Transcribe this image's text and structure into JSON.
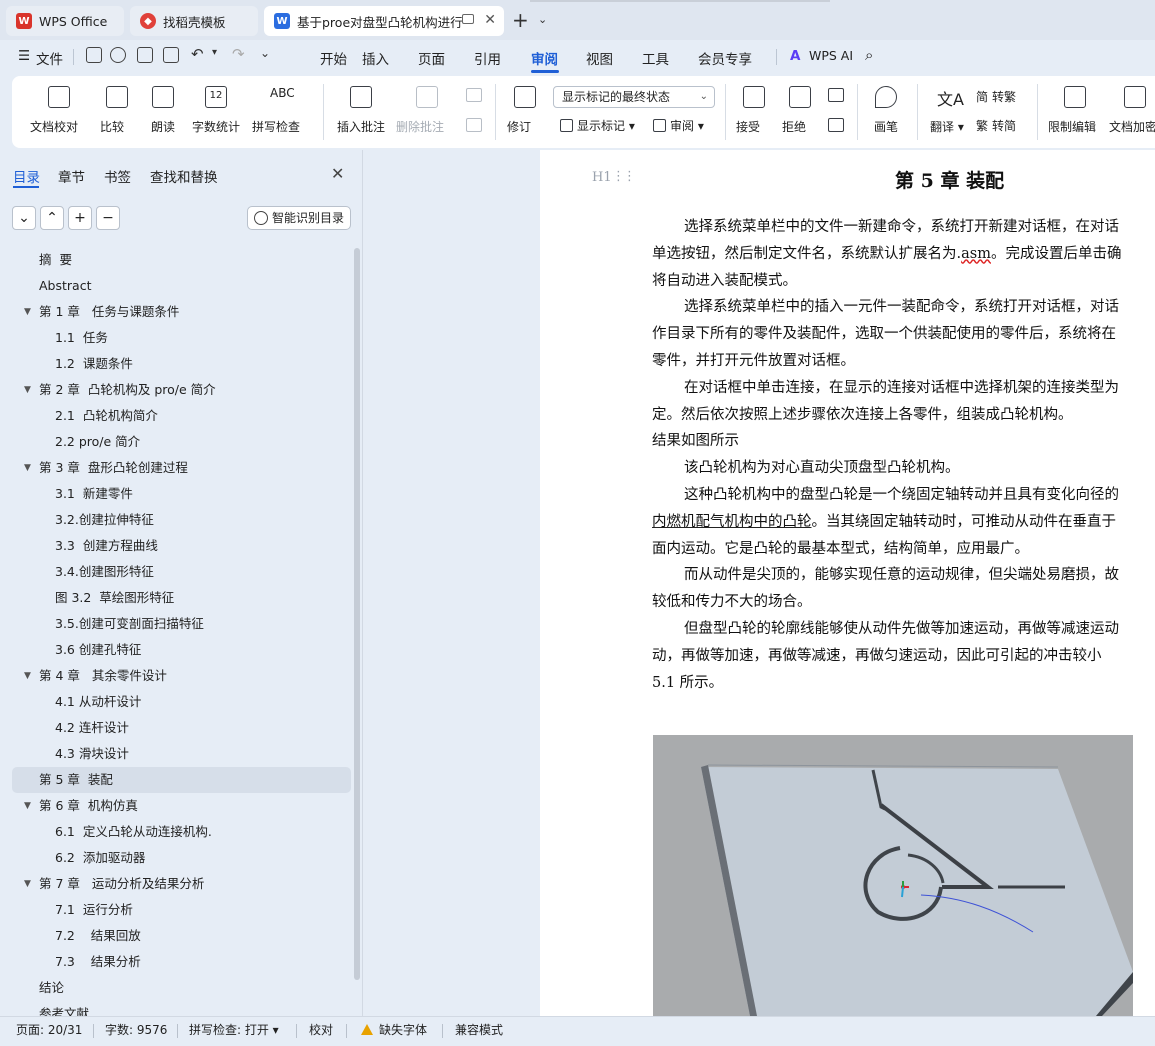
{
  "tabs": [
    {
      "label": "WPS Office",
      "icon": "wps-logo-icon"
    },
    {
      "label": "找稻壳模板",
      "icon": "docer-icon"
    },
    {
      "label": "基于proe对盘型凸轮机构进行",
      "icon": "word-doc-icon"
    }
  ],
  "menu": {
    "file": "文件",
    "items": [
      "开始",
      "插入",
      "页面",
      "引用",
      "审阅",
      "视图",
      "工具",
      "会员专享"
    ],
    "active": "审阅",
    "ai": "WPS AI"
  },
  "ribbon": {
    "proofread": "文档校对",
    "compare": "比较",
    "read_aloud": "朗读",
    "word_count": "字数统计",
    "spell_check": "拼写检查",
    "insert_comment": "插入批注",
    "delete_comment": "删除批注",
    "track_changes": "修订",
    "markup_mode": "显示标记的最终状态",
    "show_markup": "显示标记",
    "review": "审阅",
    "accept": "接受",
    "reject": "拒绝",
    "ink": "画笔",
    "translate": "翻译",
    "to_traditional": "转繁",
    "to_simplified": "转简",
    "restrict_edit": "限制编辑",
    "doc_encrypt": "文档加密"
  },
  "sidebar": {
    "tabs": [
      "目录",
      "章节",
      "书签",
      "查找和替换"
    ],
    "smart_toc": "智能识别目录",
    "toc": [
      {
        "label": "摘  要",
        "level": 1
      },
      {
        "label": "Abstract",
        "level": 1
      },
      {
        "label": "第 1 章   任务与课题条件",
        "level": 1,
        "expanded": true
      },
      {
        "label": "1.1  任务",
        "level": 2
      },
      {
        "label": "1.2  课题条件",
        "level": 2
      },
      {
        "label": "第 2 章  凸轮机构及 pro/e 简介",
        "level": 1,
        "expanded": true
      },
      {
        "label": "2.1  凸轮机构简介",
        "level": 2
      },
      {
        "label": "2.2 pro/e 简介",
        "level": 2
      },
      {
        "label": "第 3 章  盘形凸轮创建过程",
        "level": 1,
        "expanded": true
      },
      {
        "label": "3.1  新建零件",
        "level": 2
      },
      {
        "label": "3.2.创建拉伸特征",
        "level": 2
      },
      {
        "label": "3.3  创建方程曲线",
        "level": 2
      },
      {
        "label": "3.4.创建图形特征",
        "level": 2
      },
      {
        "label": "图 3.2  草绘图形特征",
        "level": 2
      },
      {
        "label": "3.5.创建可变剖面扫描特征",
        "level": 2
      },
      {
        "label": "3.6 创建孔特征",
        "level": 2
      },
      {
        "label": "第 4 章   其余零件设计",
        "level": 1,
        "expanded": true
      },
      {
        "label": "4.1 从动杆设计",
        "level": 2
      },
      {
        "label": "4.2 连杆设计",
        "level": 2
      },
      {
        "label": "4.3 滑块设计",
        "level": 2
      },
      {
        "label": "第 5 章  装配",
        "level": 1,
        "selected": true
      },
      {
        "label": "第 6 章  机构仿真",
        "level": 1,
        "expanded": true
      },
      {
        "label": "6.1  定义凸轮从动连接机构.",
        "level": 2
      },
      {
        "label": "6.2  添加驱动器",
        "level": 2
      },
      {
        "label": "第 7 章   运动分析及结果分析",
        "level": 1,
        "expanded": true
      },
      {
        "label": "7.1  运行分析",
        "level": 2
      },
      {
        "label": "7.2    结果回放",
        "level": 2
      },
      {
        "label": "7.3    结果分析",
        "level": 2
      },
      {
        "label": "结论",
        "level": 1
      },
      {
        "label": "参考文献",
        "level": 1
      }
    ]
  },
  "document": {
    "heading_marker": "H1",
    "chapter_title": "第 5 章  装配",
    "lines": [
      {
        "text": "选择系统菜单栏中的文件一新建命令，系统打开新建对话框，在对话",
        "indent": true
      },
      {
        "pre": "单选按钮，然后制定文件名，系统默认扩展名为.",
        "mark": "asm",
        "post": "。完成设置后单击确"
      },
      {
        "text": "将自动进入装配模式。"
      },
      {
        "text": "选择系统菜单栏中的插入一元件一装配命令，系统打开对话框，对话",
        "indent": true
      },
      {
        "text": "作目录下所有的零件及装配件，选取一个供装配使用的零件后，系统将在"
      },
      {
        "text": "零件，并打开元件放置对话框。"
      },
      {
        "text": "在对话框中单击连接，在显示的连接对话框中选择机架的连接类型为",
        "indent": true
      },
      {
        "text": "定。然后依次按照上述步骤依次连接上各零件，组装成凸轮机构。"
      },
      {
        "text": "结果如图所示"
      },
      {
        "text": "该凸轮机构为对心直动尖顶盘型凸轮机构。",
        "indent": true
      },
      {
        "text": "这种凸轮机构中的盘型凸轮是一个绕固定轴转动并且具有变化向径的",
        "indent": true
      },
      {
        "pre": "",
        "mark": "内燃机配气机构中的凸轮",
        "post": "。当其绕固定轴转动时，可推动从动件在垂直于",
        "mark_style": "black"
      },
      {
        "text": "面内运动。它是凸轮的最基本型式，结构简单，应用最广。"
      },
      {
        "text": "而从动件是尖顶的，能够实现任意的运动规律，但尖端处易磨损，故",
        "indent": true
      },
      {
        "text": "较低和传力不大的场合。"
      },
      {
        "text": "但盘型凸轮的轮廓线能够使从动件先做等加速运动，再做等减速运动",
        "indent": true
      },
      {
        "text": "动，再做等加速，再做等减速，再做匀速运动，因此可引起的冲击较小"
      },
      {
        "text": "5.1 所示。"
      }
    ]
  },
  "status": {
    "page": "页面: 20/31",
    "words": "字数: 9576",
    "spell": "拼写检查: 打开",
    "proof": "校对",
    "missing_font": "缺失字体",
    "compat": "兼容模式"
  },
  "colors": {
    "accent": "#1f5fd6",
    "wps_red": "#d9342b"
  }
}
